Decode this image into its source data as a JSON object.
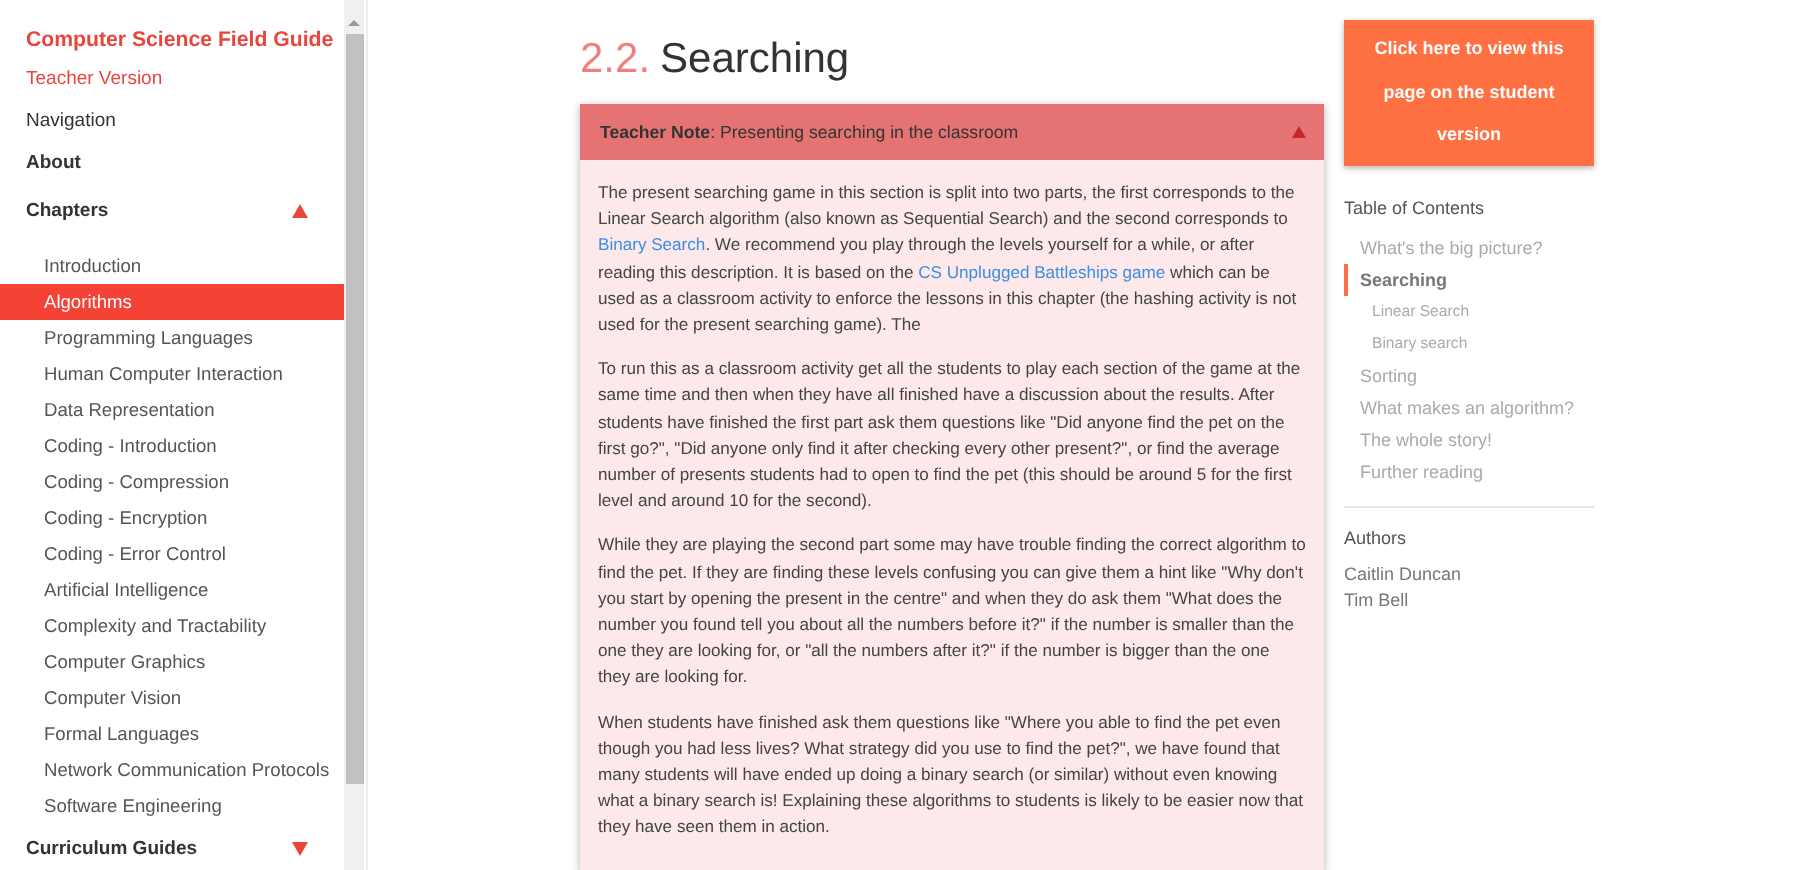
{
  "sidebar": {
    "title": "Computer Science Field Guide",
    "subtitle": "Teacher Version",
    "links": [
      {
        "label": "Navigation",
        "bold": false
      },
      {
        "label": "About",
        "bold": true
      }
    ],
    "sections": [
      {
        "label": "Chapters",
        "expanded": true,
        "items": [
          {
            "label": "Introduction",
            "selected": false
          },
          {
            "label": "Algorithms",
            "selected": true
          },
          {
            "label": "Programming Languages",
            "selected": false
          },
          {
            "label": "Human Computer Interaction",
            "selected": false
          },
          {
            "label": "Data Representation",
            "selected": false
          },
          {
            "label": "Coding - Introduction",
            "selected": false
          },
          {
            "label": "Coding - Compression",
            "selected": false
          },
          {
            "label": "Coding - Encryption",
            "selected": false
          },
          {
            "label": "Coding - Error Control",
            "selected": false
          },
          {
            "label": "Artificial Intelligence",
            "selected": false
          },
          {
            "label": "Complexity and Tractability",
            "selected": false
          },
          {
            "label": "Computer Graphics",
            "selected": false
          },
          {
            "label": "Computer Vision",
            "selected": false
          },
          {
            "label": "Formal Languages",
            "selected": false
          },
          {
            "label": "Network Communication Protocols",
            "selected": false
          },
          {
            "label": "Software Engineering",
            "selected": false
          }
        ]
      },
      {
        "label": "Curriculum Guides",
        "expanded": false
      }
    ]
  },
  "heading": {
    "number": "2.2.",
    "title": "Searching"
  },
  "note": {
    "label": "Teacher Note",
    "title": ": Presenting searching in the classroom",
    "expanded": true,
    "paragraphs": [
      [
        {
          "kind": "text",
          "text": "The present searching game in this section is split into two parts, the first corresponds to the Linear Search algorithm (also known as Sequential Search) and the second corresponds to "
        },
        {
          "kind": "link",
          "text": "Binary Search"
        },
        {
          "kind": "text",
          "text": ". We recommend you play through the levels yourself for a while, or after reading this description. It is based on the "
        },
        {
          "kind": "link",
          "text": "CS Unplugged Battleships game"
        },
        {
          "kind": "text",
          "text": " which can be used as a classroom activity to enforce the lessons in this chapter (the hashing activity is not used for the present searching game). The"
        }
      ],
      [
        {
          "kind": "text",
          "text": "To run this as a classroom activity get all the students to play each section of the game at the same time and then when they have all finished have a discussion about the results. After students have finished the first part ask them questions like \"Did anyone find the pet on the first go?\", \"Did anyone only find it after checking every other present?\", or find the average number of presents students had to open to find the pet (this should be around 5 for the first level and around 10 for the second)."
        }
      ],
      [
        {
          "kind": "text",
          "text": "While they are playing the second part some may have trouble finding the correct algorithm to find the pet. If they are finding these levels confusing you can give them a hint like \"Why don't you start by opening the present in the centre\" and when they do ask them \"What does the number you found tell you about all the numbers before it?\" if the number is smaller than the one they are looking for, or \"all the numbers after it?\" if the number is bigger than the one they are looking for."
        }
      ],
      [
        {
          "kind": "text",
          "text": "When students have finished ask them questions like \"Where you able to find the pet even though you had less lives? What strategy did you use to find the pet?\", we have found that many students will have ended up doing a binary search (or similar) without even knowing what a binary search is! Explaining these algorithms to students is likely to be easier now that they have seen them in action."
        }
      ]
    ]
  },
  "student_button": "Click here to view this page on the student version",
  "toc": {
    "title": "Table of Contents",
    "items": [
      {
        "label": "What's the big picture?",
        "selected": false
      },
      {
        "label": "Searching",
        "selected": true,
        "children": [
          {
            "label": "Linear Search"
          },
          {
            "label": "Binary search"
          }
        ]
      },
      {
        "label": "Sorting",
        "selected": false
      },
      {
        "label": "What makes an algorithm?",
        "selected": false
      },
      {
        "label": "The whole story!",
        "selected": false
      },
      {
        "label": "Further reading",
        "selected": false
      }
    ]
  },
  "authors": {
    "title": "Authors",
    "names": [
      "Caitlin Duncan",
      "Tim Bell"
    ]
  }
}
